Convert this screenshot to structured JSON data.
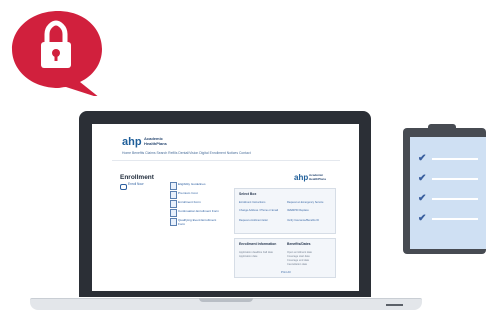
{
  "lock_badge": {
    "icon": "lock-icon",
    "color": "#d1203d"
  },
  "site": {
    "logo_abbr": "ahp",
    "logo_name_line1": "Academic",
    "logo_name_line2": "HealthPlans",
    "nav": "Home   Benefits   Claims   Search   Refills   Dental/Vision   Digital   Enrollment   Notices   Contact"
  },
  "enrollment": {
    "title": "Enrollment",
    "subtitle": "Enroll Now",
    "documents": [
      "Eligibility Guidelines",
      "Premium Cost",
      "Enrollment Form",
      "Continuation Enrollment Form",
      "Qualifying Event Enrollment Form"
    ]
  },
  "sidebar_logo": {
    "abbr": "ahp",
    "line1": "Academic",
    "line2": "HealthPlans"
  },
  "select_box": {
    "title": "Select Box",
    "left_items": [
      "Enrollment Instructions",
      "Change Address / Phone or Email",
      "Request enrollment letter"
    ],
    "right_items": [
      "Request an Emergency Service",
      "ID/EMPID Replace",
      "Verify Insurance/Benefits ID"
    ]
  },
  "enrollment_info": {
    "col1_title": "Enrollment Information",
    "col2_title": "Benefits/Dates",
    "left_lines": [
      "Application deadline  Fall date",
      "Application date"
    ],
    "right_lines": [
      "Open enrollment date",
      "Coverage start date",
      "Coverage end date",
      "Cancellation date"
    ],
    "button": "Print All"
  },
  "clipboard": {
    "icon": "clipboard-checklist-icon",
    "items": 4
  }
}
